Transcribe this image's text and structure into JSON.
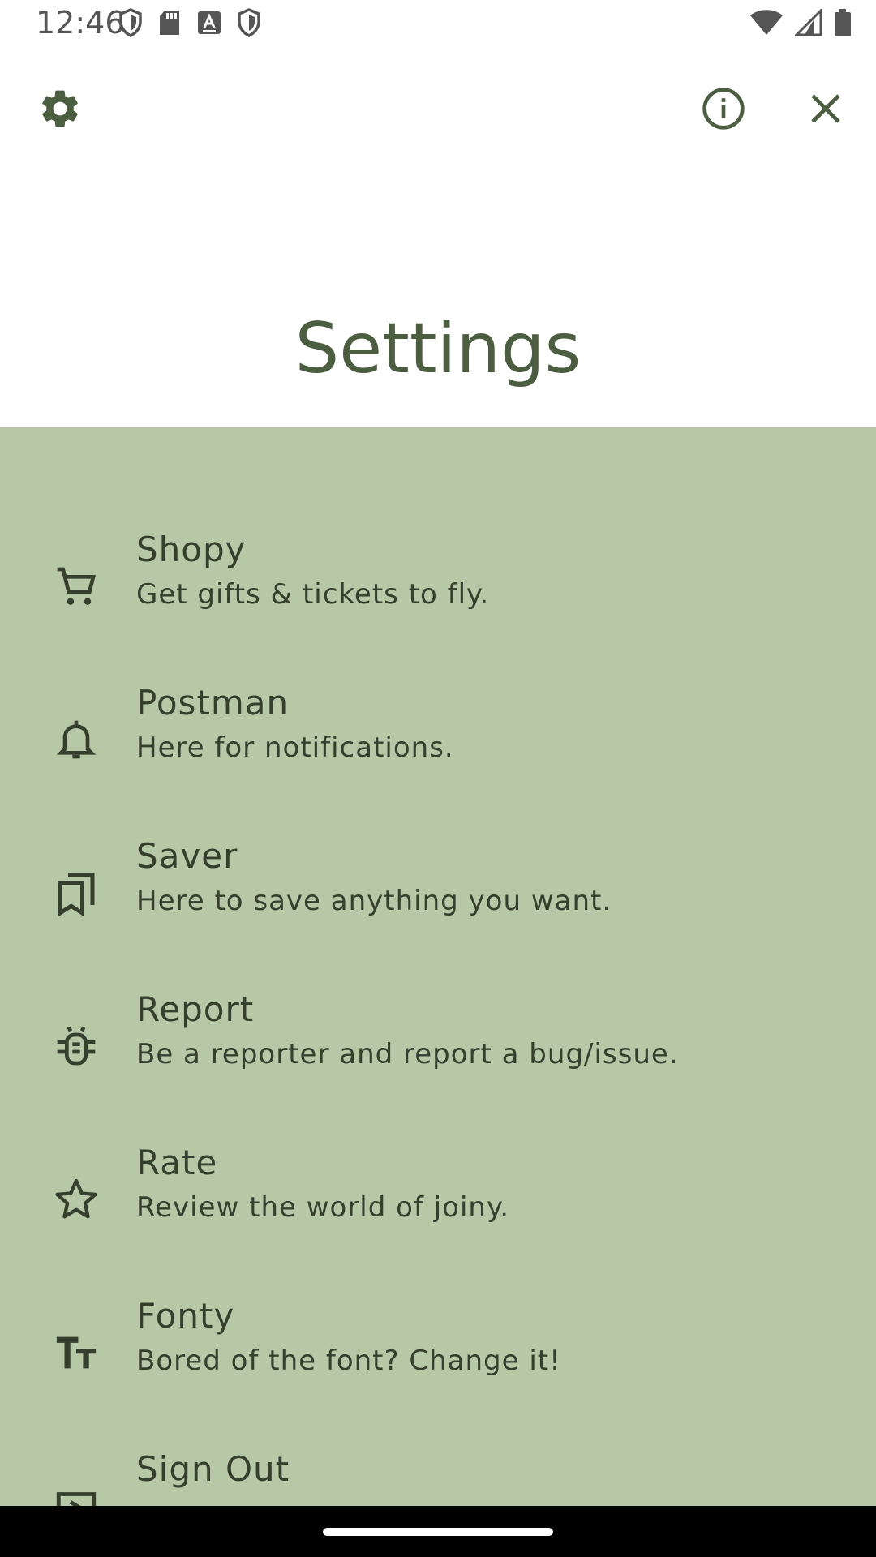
{
  "status_bar": {
    "time": "12:46",
    "left_icons": [
      "shield-icon",
      "sd-card-icon",
      "keyboard-a-icon",
      "shield-icon"
    ],
    "right_icons": [
      "wifi-icon",
      "cell-signal-icon",
      "battery-icon"
    ]
  },
  "topbar": {
    "left_icon": "gear-icon",
    "right_icons": [
      "info-icon",
      "close-icon"
    ]
  },
  "page": {
    "title": "Settings"
  },
  "colors": {
    "title_green": "#4c5e40",
    "panel_bg": "#b7c8a7",
    "item_text": "#34402d"
  },
  "settings_items": [
    {
      "label": "Shopy",
      "description": "Get gifts & tickets to fly.",
      "icon": "cart-icon"
    },
    {
      "label": "Postman",
      "description": "Here for notifications.",
      "icon": "bell-icon"
    },
    {
      "label": "Saver",
      "description": "Here to save anything you want.",
      "icon": "bookmarks-icon"
    },
    {
      "label": "Report",
      "description": "Be a reporter and report a bug/issue.",
      "icon": "bug-icon"
    },
    {
      "label": "Rate",
      "description": "Review the world of joiny.",
      "icon": "star-icon"
    },
    {
      "label": "Fonty",
      "description": "Bored of the font? Change it!",
      "icon": "text-size-icon"
    },
    {
      "label": "Sign Out",
      "description": "",
      "icon": "sign-out-icon"
    }
  ]
}
